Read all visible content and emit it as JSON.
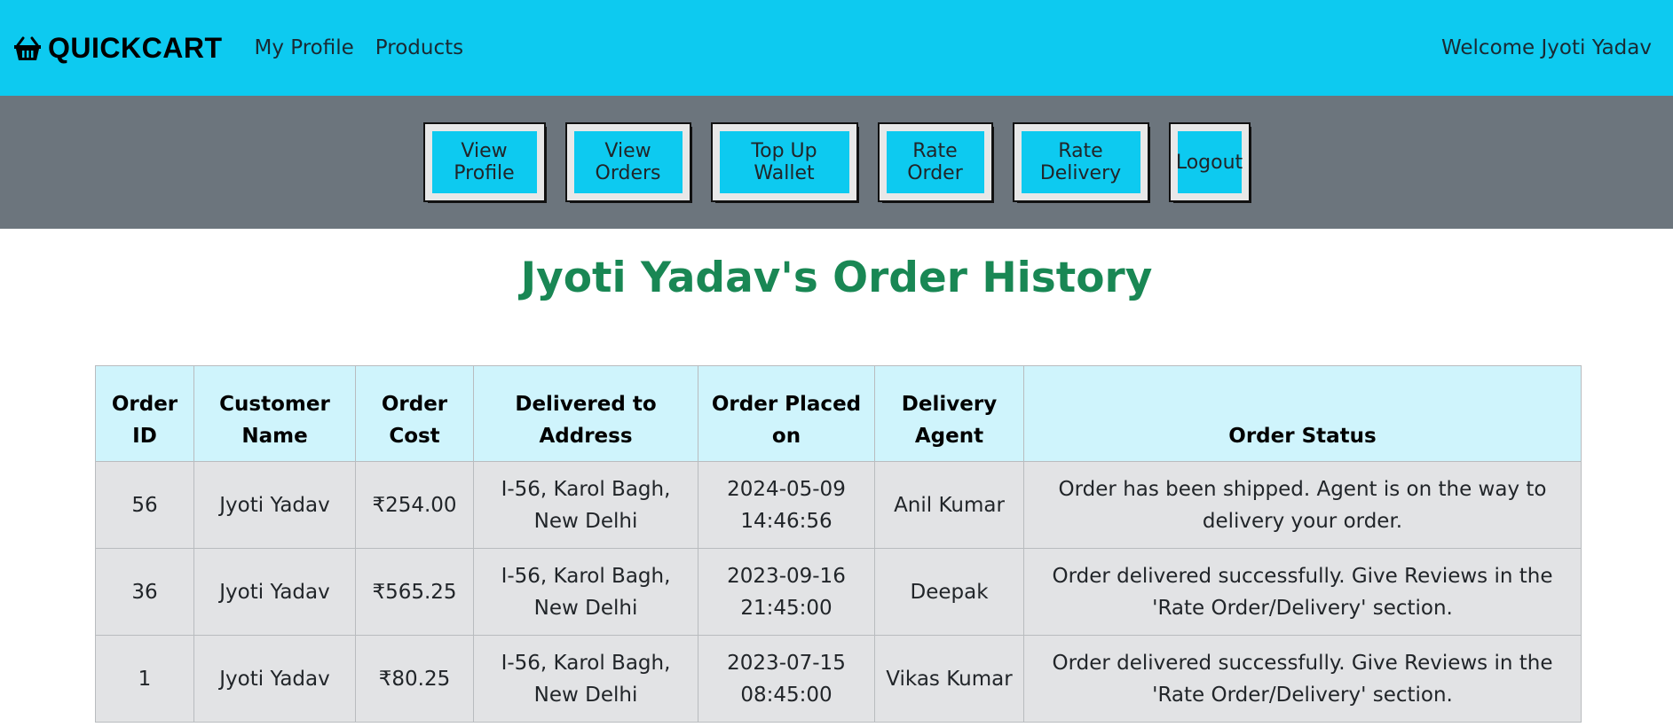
{
  "header": {
    "brand": "QUICKCART",
    "nav": [
      "My Profile",
      "Products"
    ],
    "welcome": "Welcome Jyoti Yadav"
  },
  "actions": [
    "View Profile",
    "View Orders",
    "Top Up Wallet",
    "Rate Order",
    "Rate Delivery",
    "Logout"
  ],
  "page": {
    "title": "Jyoti Yadav's Order History"
  },
  "table": {
    "headers": [
      "Order ID",
      "Customer Name",
      "Order Cost",
      "Delivered to Address",
      "Order Placed on",
      "Delivery Agent",
      "Order Status"
    ],
    "rows": [
      [
        "56",
        "Jyoti Yadav",
        "₹254.00",
        "I-56, Karol Bagh, New Delhi",
        "2024-05-09 14:46:56",
        "Anil Kumar",
        "Order has been shipped. Agent is on the way to delivery your order."
      ],
      [
        "36",
        "Jyoti Yadav",
        "₹565.25",
        "I-56, Karol Bagh, New Delhi",
        "2023-09-16 21:45:00",
        "Deepak",
        "Order delivered successfully. Give Reviews in the 'Rate Order/Delivery' section."
      ],
      [
        "1",
        "Jyoti Yadav",
        "₹80.25",
        "I-56, Karol Bagh, New Delhi",
        "2023-07-15 08:45:00",
        "Vikas Kumar",
        "Order delivered successfully. Give Reviews in the 'Rate Order/Delivery' section."
      ]
    ]
  },
  "colors": {
    "topbar": "#0dcaf0",
    "actionbar": "#6c757d",
    "title": "#198754",
    "table_header": "#cff4fc",
    "table_row": "#e2e3e5"
  },
  "icons": {
    "brand": "shopping-basket-icon"
  }
}
